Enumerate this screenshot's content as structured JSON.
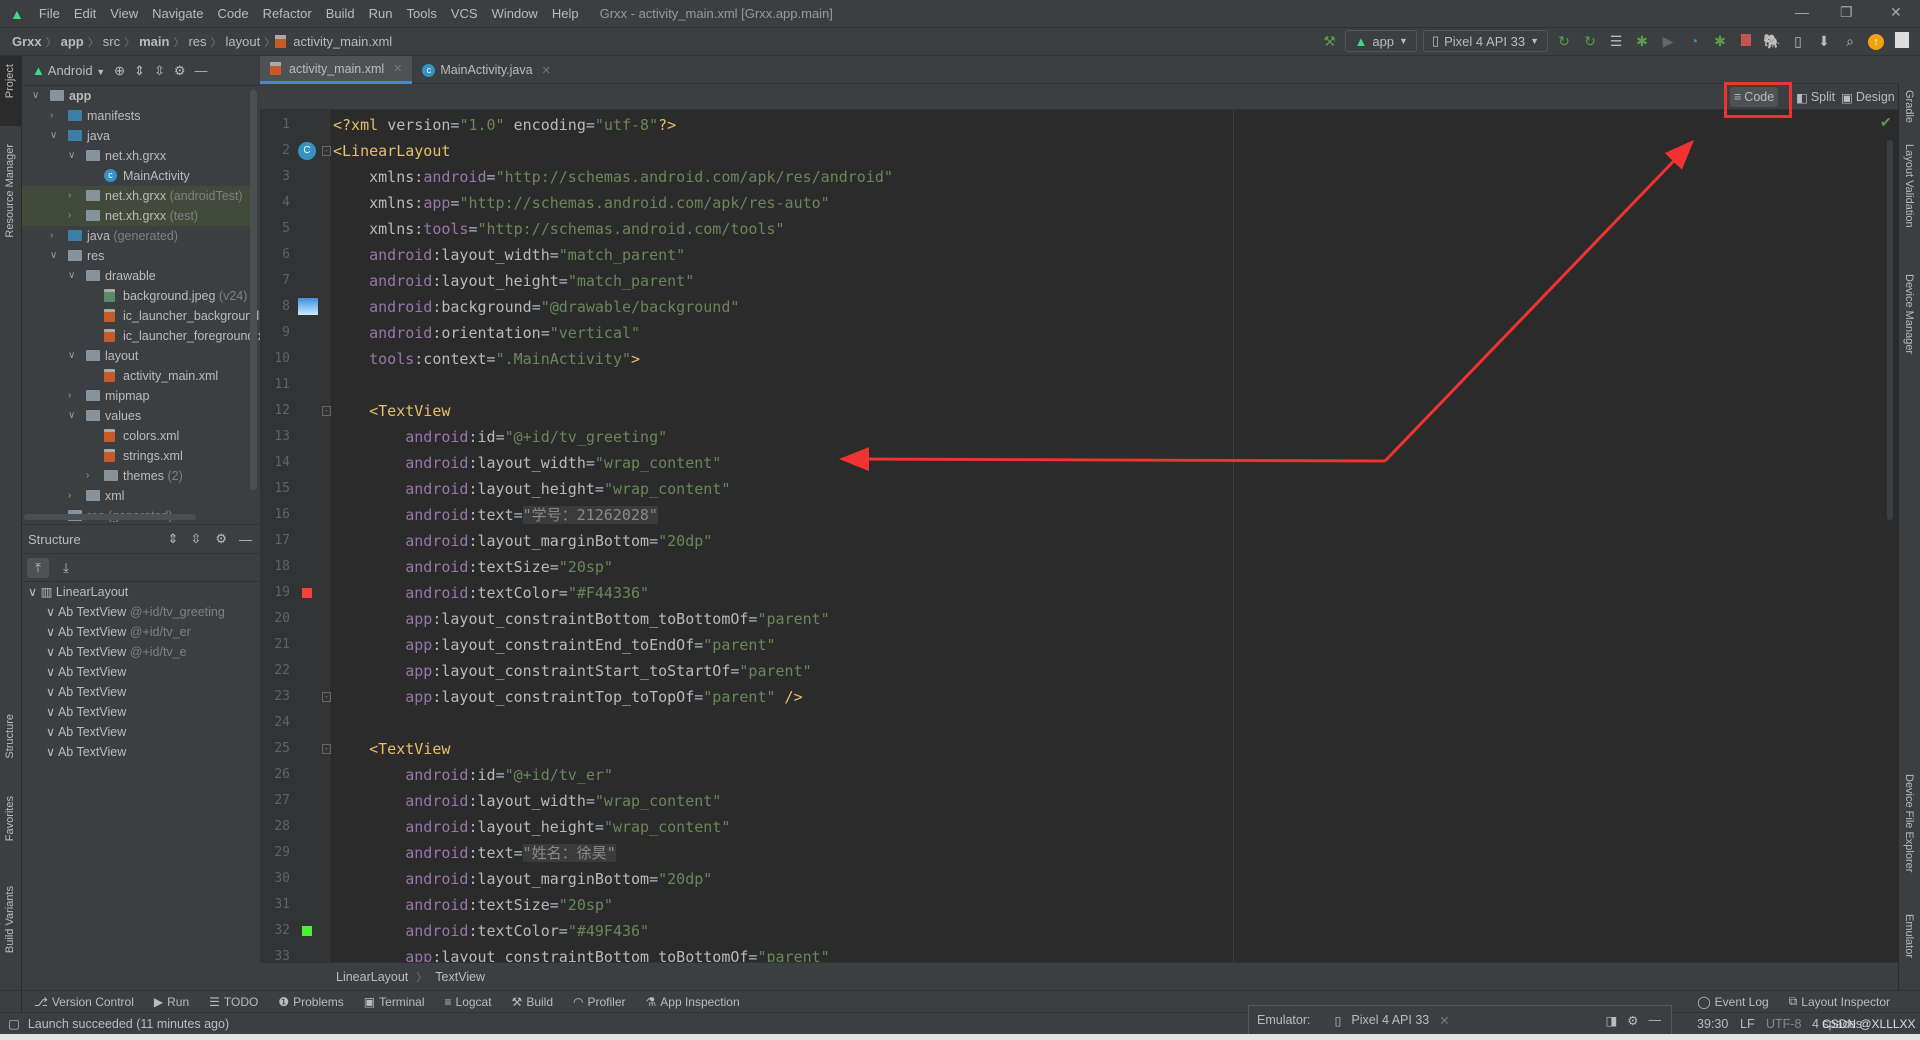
{
  "window": {
    "title": "Grxx - activity_main.xml [Grxx.app.main]",
    "menu": [
      "File",
      "Edit",
      "View",
      "Navigate",
      "Code",
      "Refactor",
      "Build",
      "Run",
      "Tools",
      "VCS",
      "Window",
      "Help"
    ]
  },
  "breadcrumb": [
    "Grxx",
    "app",
    "src",
    "main",
    "res",
    "layout",
    "activity_main.xml"
  ],
  "toolbar": {
    "run_config": "app",
    "device": "Pixel 4 API 33"
  },
  "left_stripe": [
    "Project",
    "Resource Manager",
    "Structure",
    "Favorites",
    "Build Variants"
  ],
  "right_stripe": [
    "Gradle",
    "Layout Validation",
    "Device Manager",
    "Device File Explorer",
    "Emulator"
  ],
  "project": {
    "view": "Android",
    "tree": [
      {
        "label": "app",
        "level": 0,
        "state": "open",
        "icon": "module",
        "bold": true
      },
      {
        "label": "manifests",
        "level": 1,
        "state": "closed",
        "icon": "folder-blue"
      },
      {
        "label": "java",
        "level": 1,
        "state": "open",
        "icon": "folder-blue"
      },
      {
        "label": "net.xh.grxx",
        "level": 2,
        "state": "open",
        "icon": "package"
      },
      {
        "label": "MainActivity",
        "level": 3,
        "icon": "class"
      },
      {
        "label": "net.xh.grxx",
        "suffix": "(androidTest)",
        "level": 2,
        "state": "closed",
        "icon": "package",
        "hl": true
      },
      {
        "label": "net.xh.grxx",
        "suffix": "(test)",
        "level": 2,
        "state": "closed",
        "icon": "package",
        "hl": true
      },
      {
        "label": "java",
        "suffix": "(generated)",
        "level": 1,
        "state": "closed",
        "icon": "folder-blue"
      },
      {
        "label": "res",
        "level": 1,
        "state": "open",
        "icon": "folder"
      },
      {
        "label": "drawable",
        "level": 2,
        "state": "open",
        "icon": "package"
      },
      {
        "label": "background.jpeg",
        "suffix": "(v24)",
        "level": 3,
        "icon": "img"
      },
      {
        "label": "ic_launcher_background.",
        "level": 3,
        "icon": "xml"
      },
      {
        "label": "ic_launcher_foreground.x",
        "level": 3,
        "icon": "xml"
      },
      {
        "label": "layout",
        "level": 2,
        "state": "open",
        "icon": "package"
      },
      {
        "label": "activity_main.xml",
        "level": 3,
        "icon": "xml"
      },
      {
        "label": "mipmap",
        "level": 2,
        "state": "closed",
        "icon": "package"
      },
      {
        "label": "values",
        "level": 2,
        "state": "open",
        "icon": "package"
      },
      {
        "label": "colors.xml",
        "level": 3,
        "icon": "xml"
      },
      {
        "label": "strings.xml",
        "level": 3,
        "icon": "xml"
      },
      {
        "label": "themes",
        "suffix": "(2)",
        "level": 3,
        "state": "closed",
        "icon": "package"
      },
      {
        "label": "xml",
        "level": 2,
        "state": "closed",
        "icon": "package"
      },
      {
        "label": "res",
        "suffix": "(generated)",
        "level": 1,
        "icon": "folder",
        "muted": true
      }
    ]
  },
  "structure": {
    "title": "Structure",
    "items": [
      {
        "label": "LinearLayout",
        "level": 0
      },
      {
        "label": "Ab TextView",
        "id": "@+id/tv_greeting",
        "level": 1
      },
      {
        "label": "Ab TextView",
        "id": "@+id/tv_er",
        "level": 1
      },
      {
        "label": "Ab TextView",
        "id": "@+id/tv_e",
        "level": 1
      },
      {
        "label": "Ab TextView",
        "level": 1
      },
      {
        "label": "Ab TextView",
        "level": 1
      },
      {
        "label": "Ab TextView",
        "level": 1
      },
      {
        "label": "Ab TextView",
        "level": 1
      },
      {
        "label": "Ab TextView",
        "level": 1
      }
    ]
  },
  "editor": {
    "tabs": [
      {
        "label": "activity_main.xml",
        "active": true,
        "icon": "xml"
      },
      {
        "label": "MainActivity.java",
        "active": false,
        "icon": "class"
      }
    ],
    "modes": [
      "Code",
      "Split",
      "Design"
    ],
    "active_mode": "Code",
    "lines": [
      [
        [
          "tag",
          "<?xml "
        ],
        [
          "attr",
          "version"
        ],
        [
          "eq",
          "="
        ],
        [
          "str",
          "\"1.0\""
        ],
        [
          "attr",
          " encoding"
        ],
        [
          "eq",
          "="
        ],
        [
          "str",
          "\"utf-8\""
        ],
        [
          "tag",
          "?>"
        ]
      ],
      [
        [
          "tag",
          "<LinearLayout"
        ]
      ],
      [
        [
          "attr",
          "    xmlns:"
        ],
        [
          "ns",
          "android"
        ],
        [
          "eq",
          "="
        ],
        [
          "str",
          "\"http://schemas.android.com/apk/res/android\""
        ]
      ],
      [
        [
          "attr",
          "    xmlns:"
        ],
        [
          "ns",
          "app"
        ],
        [
          "eq",
          "="
        ],
        [
          "str",
          "\"http://schemas.android.com/apk/res-auto\""
        ]
      ],
      [
        [
          "attr",
          "    xmlns:"
        ],
        [
          "ns",
          "tools"
        ],
        [
          "eq",
          "="
        ],
        [
          "str",
          "\"http://schemas.android.com/tools\""
        ]
      ],
      [
        [
          "ns",
          "    android"
        ],
        [
          "attr",
          ":layout_width"
        ],
        [
          "eq",
          "="
        ],
        [
          "str",
          "\"match_parent\""
        ]
      ],
      [
        [
          "ns",
          "    android"
        ],
        [
          "attr",
          ":layout_height"
        ],
        [
          "eq",
          "="
        ],
        [
          "str",
          "\"match_parent\""
        ]
      ],
      [
        [
          "ns",
          "    android"
        ],
        [
          "attr",
          ":background"
        ],
        [
          "eq",
          "="
        ],
        [
          "str",
          "\"@drawable/background\""
        ]
      ],
      [
        [
          "ns",
          "    android"
        ],
        [
          "attr",
          ":orientation"
        ],
        [
          "eq",
          "="
        ],
        [
          "str",
          "\"vertical\""
        ]
      ],
      [
        [
          "ns",
          "    tools"
        ],
        [
          "attr",
          ":context"
        ],
        [
          "eq",
          "="
        ],
        [
          "str",
          "\".MainActivity\""
        ],
        [
          "tag",
          ">"
        ]
      ],
      [],
      [
        [
          "tag",
          "    <TextView"
        ]
      ],
      [
        [
          "ns",
          "        android"
        ],
        [
          "attr",
          ":id"
        ],
        [
          "eq",
          "="
        ],
        [
          "str",
          "\"@+id/tv_greeting\""
        ]
      ],
      [
        [
          "ns",
          "        android"
        ],
        [
          "attr",
          ":layout_width"
        ],
        [
          "eq",
          "="
        ],
        [
          "str",
          "\"wrap_content\""
        ]
      ],
      [
        [
          "ns",
          "        android"
        ],
        [
          "attr",
          ":layout_height"
        ],
        [
          "eq",
          "="
        ],
        [
          "str",
          "\"wrap_content\""
        ]
      ],
      [
        [
          "ns",
          "        android"
        ],
        [
          "attr",
          ":text"
        ],
        [
          "eq",
          "="
        ],
        [
          "hl",
          "\"学号：21262028\""
        ]
      ],
      [
        [
          "ns",
          "        android"
        ],
        [
          "attr",
          ":layout_marginBottom"
        ],
        [
          "eq",
          "="
        ],
        [
          "str",
          "\"20dp\""
        ]
      ],
      [
        [
          "ns",
          "        android"
        ],
        [
          "attr",
          ":textSize"
        ],
        [
          "eq",
          "="
        ],
        [
          "str",
          "\"20sp\""
        ]
      ],
      [
        [
          "ns",
          "        android"
        ],
        [
          "attr",
          ":textColor"
        ],
        [
          "eq",
          "="
        ],
        [
          "str",
          "\"#F44336\""
        ]
      ],
      [
        [
          "ns",
          "        app"
        ],
        [
          "attr",
          ":layout_constraintBottom_toBottomOf"
        ],
        [
          "eq",
          "="
        ],
        [
          "str",
          "\"parent\""
        ]
      ],
      [
        [
          "ns",
          "        app"
        ],
        [
          "attr",
          ":layout_constraintEnd_toEndOf"
        ],
        [
          "eq",
          "="
        ],
        [
          "str",
          "\"parent\""
        ]
      ],
      [
        [
          "ns",
          "        app"
        ],
        [
          "attr",
          ":layout_constraintStart_toStartOf"
        ],
        [
          "eq",
          "="
        ],
        [
          "str",
          "\"parent\""
        ]
      ],
      [
        [
          "ns",
          "        app"
        ],
        [
          "attr",
          ":layout_constraintTop_toTopOf"
        ],
        [
          "eq",
          "="
        ],
        [
          "str",
          "\"parent\""
        ],
        [
          "tag",
          " />"
        ]
      ],
      [],
      [
        [
          "tag",
          "    <TextView"
        ]
      ],
      [
        [
          "ns",
          "        android"
        ],
        [
          "attr",
          ":id"
        ],
        [
          "eq",
          "="
        ],
        [
          "str",
          "\"@+id/tv_er\""
        ]
      ],
      [
        [
          "ns",
          "        android"
        ],
        [
          "attr",
          ":layout_width"
        ],
        [
          "eq",
          "="
        ],
        [
          "str",
          "\"wrap_content\""
        ]
      ],
      [
        [
          "ns",
          "        android"
        ],
        [
          "attr",
          ":layout_height"
        ],
        [
          "eq",
          "="
        ],
        [
          "str",
          "\"wrap_content\""
        ]
      ],
      [
        [
          "ns",
          "        android"
        ],
        [
          "attr",
          ":text"
        ],
        [
          "eq",
          "="
        ],
        [
          "hl",
          "\"姓名：徐昊\""
        ]
      ],
      [
        [
          "ns",
          "        android"
        ],
        [
          "attr",
          ":layout_marginBottom"
        ],
        [
          "eq",
          "="
        ],
        [
          "str",
          "\"20dp\""
        ]
      ],
      [
        [
          "ns",
          "        android"
        ],
        [
          "attr",
          ":textSize"
        ],
        [
          "eq",
          "="
        ],
        [
          "str",
          "\"20sp\""
        ]
      ],
      [
        [
          "ns",
          "        android"
        ],
        [
          "attr",
          ":textColor"
        ],
        [
          "eq",
          "="
        ],
        [
          "str",
          "\"#49F436\""
        ]
      ],
      [
        [
          "ns",
          "        app"
        ],
        [
          "attr",
          ":layout_constraintBottom_toBottomOf"
        ],
        [
          "eq",
          "="
        ],
        [
          "str",
          "\"parent\""
        ]
      ]
    ],
    "gutter_colors": {
      "19": "#F44336",
      "32": "#49F436"
    },
    "breadcrumb": [
      "LinearLayout",
      "TextView"
    ]
  },
  "tool_windows": {
    "left": [
      "Version Control",
      "Run",
      "TODO",
      "Problems",
      "Terminal",
      "Logcat",
      "Build",
      "Profiler",
      "App Inspection"
    ],
    "right": [
      "Event Log",
      "Layout Inspector"
    ]
  },
  "status": {
    "message": "Launch succeeded (11 minutes ago)",
    "emulator_label": "Emulator:",
    "emulator_device": "Pixel 4 API 33",
    "position": "39:30",
    "line_sep": "LF",
    "encoding": "UTF-8",
    "indent": "4 spaces",
    "watermark": "CSDN @XLLLXX"
  },
  "annotation": {
    "color": "#f03232"
  }
}
